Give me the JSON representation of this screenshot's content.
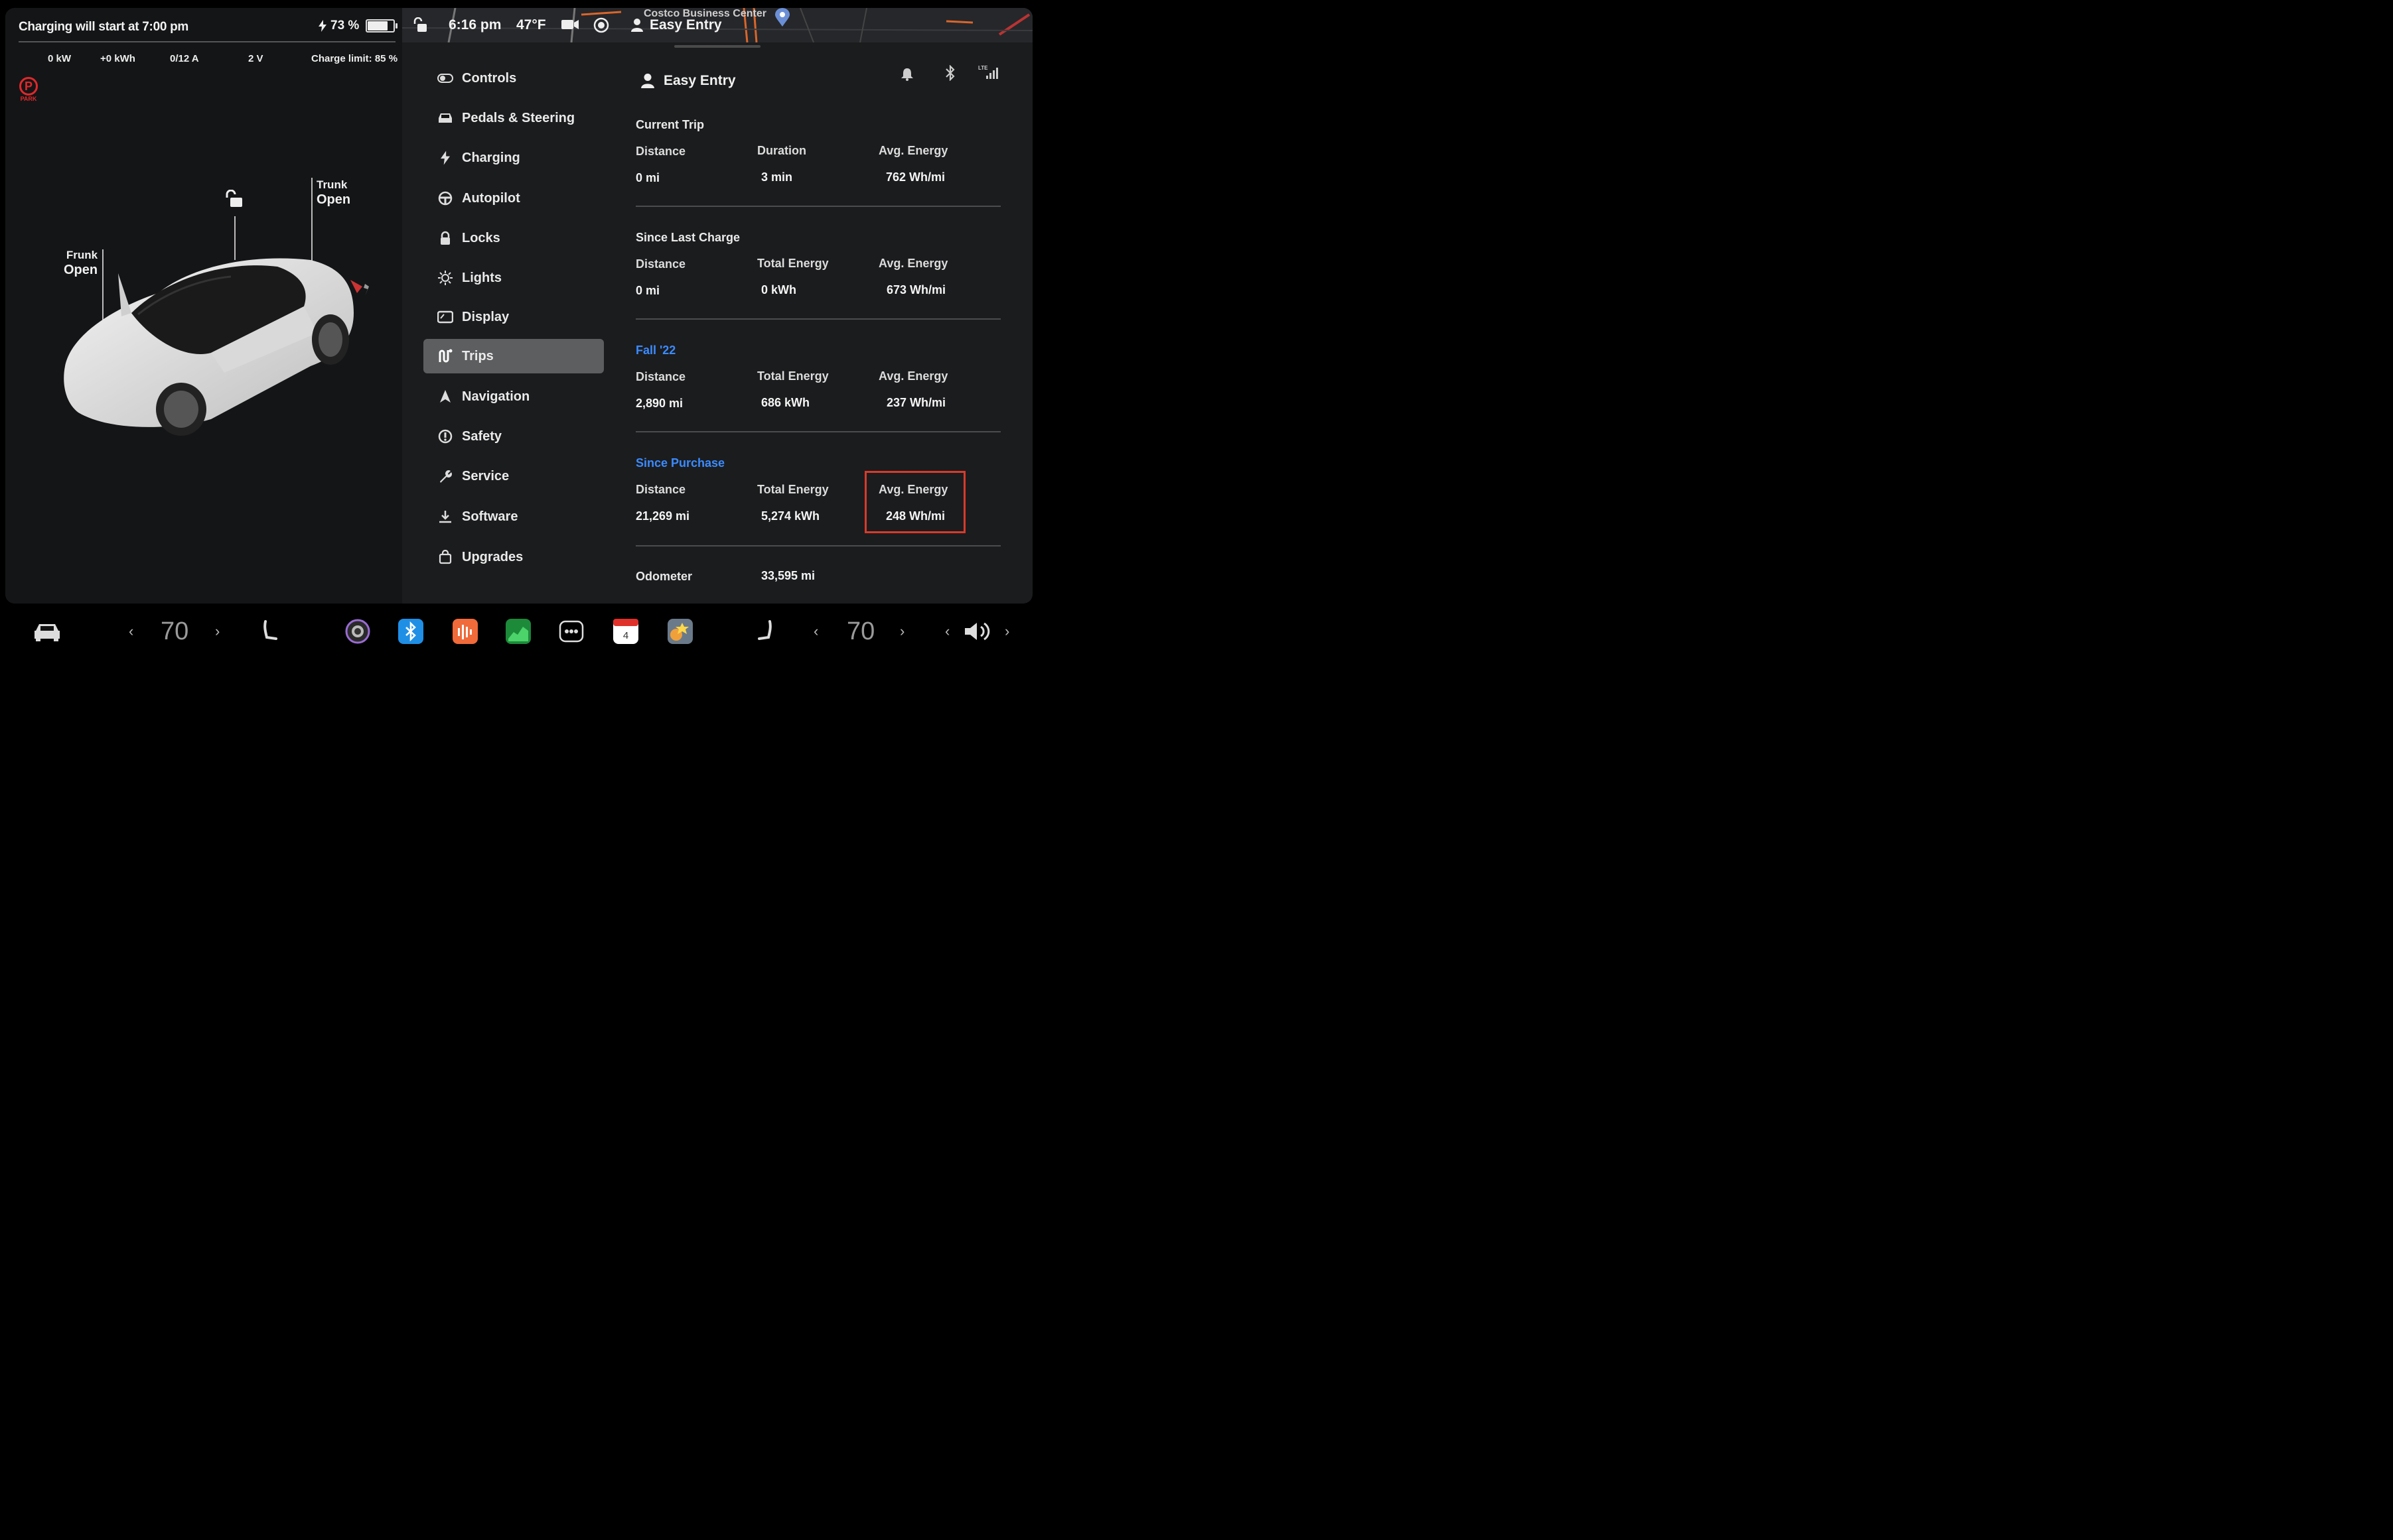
{
  "charging": {
    "title": "Charging will start at 7:00 pm",
    "battery": "73 %",
    "power": "0 kW",
    "energy": "+0 kWh",
    "current": "0/12 A",
    "voltage": "2 V",
    "limit": "Charge limit: 85 %"
  },
  "park_label": "PARK",
  "car": {
    "frunk_label": "Frunk",
    "frunk_state": "Open",
    "trunk_label": "Trunk",
    "trunk_state": "Open"
  },
  "statusbar": {
    "time": "6:16 pm",
    "temperature": "47°F",
    "profile": "Easy Entry",
    "map_label": "Costco Business Center"
  },
  "menu": [
    {
      "label": "Controls",
      "icon": "toggle-icon"
    },
    {
      "label": "Pedals & Steering",
      "icon": "car-icon"
    },
    {
      "label": "Charging",
      "icon": "bolt-icon"
    },
    {
      "label": "Autopilot",
      "icon": "steering-wheel-icon"
    },
    {
      "label": "Locks",
      "icon": "lock-icon"
    },
    {
      "label": "Lights",
      "icon": "sun-icon"
    },
    {
      "label": "Display",
      "icon": "display-icon"
    },
    {
      "label": "Trips",
      "icon": "trips-icon",
      "active": true
    },
    {
      "label": "Navigation",
      "icon": "navigation-icon"
    },
    {
      "label": "Safety",
      "icon": "safety-icon"
    },
    {
      "label": "Service",
      "icon": "wrench-icon"
    },
    {
      "label": "Software",
      "icon": "download-icon"
    },
    {
      "label": "Upgrades",
      "icon": "bag-icon"
    }
  ],
  "content": {
    "profile": "Easy Entry",
    "current_trip": {
      "title": "Current Trip",
      "labels": [
        "Distance",
        "Duration",
        "Avg. Energy"
      ],
      "values": [
        "0 mi",
        "3 min",
        "762 Wh/mi"
      ]
    },
    "since_last_charge": {
      "title": "Since Last Charge",
      "labels": [
        "Distance",
        "Total Energy",
        "Avg. Energy"
      ],
      "values": [
        "0 mi",
        "0 kWh",
        "673 Wh/mi"
      ]
    },
    "fall22": {
      "title": "Fall '22",
      "labels": [
        "Distance",
        "Total Energy",
        "Avg. Energy"
      ],
      "values": [
        "2,890 mi",
        "686 kWh",
        "237 Wh/mi"
      ]
    },
    "since_purchase": {
      "title": "Since Purchase",
      "labels": [
        "Distance",
        "Total Energy",
        "Avg. Energy"
      ],
      "values": [
        "21,269 mi",
        "5,274 kWh",
        "248 Wh/mi"
      ]
    },
    "odometer_label": "Odometer",
    "odometer_value": "33,595 mi"
  },
  "dock": {
    "temp_left": "70",
    "temp_right": "70",
    "calendar_day": "4"
  },
  "colors": {
    "accent_blue": "#3b8bff",
    "highlight_red": "#d93a2b",
    "park_red": "#e0282a"
  }
}
